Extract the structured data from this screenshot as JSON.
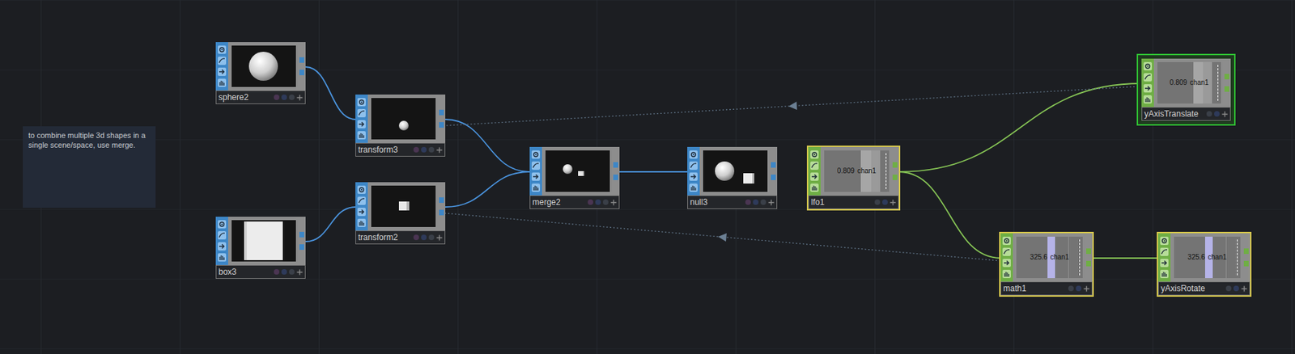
{
  "comment": {
    "text": "to combine multiple 3d shapes in a single scene/space, use merge."
  },
  "nodes": [
    {
      "name": "sphere2",
      "family": "sop",
      "preview": "sphere",
      "selected": false,
      "current": false
    },
    {
      "name": "transform3",
      "family": "sop",
      "preview": "small-sphere",
      "selected": false,
      "current": false
    },
    {
      "name": "box3",
      "family": "sop",
      "preview": "box",
      "selected": false,
      "current": false
    },
    {
      "name": "transform2",
      "family": "sop",
      "preview": "small-box",
      "selected": false,
      "current": false
    },
    {
      "name": "merge2",
      "family": "sop",
      "preview": "merge",
      "selected": false,
      "current": false
    },
    {
      "name": "null3",
      "family": "sop",
      "preview": "null",
      "selected": false,
      "current": false
    },
    {
      "name": "lfo1",
      "family": "chop",
      "preview": "chop-lfo",
      "value": "0.809",
      "channel": "chan1",
      "selected": true,
      "current": false
    },
    {
      "name": "yAxisTranslate",
      "family": "chop",
      "preview": "chop-lfo",
      "value": "0.809",
      "channel": "chan1",
      "selected": false,
      "current": true
    },
    {
      "name": "math1",
      "family": "chop",
      "preview": "chop-math",
      "value": "325.6",
      "channel": "chan1",
      "selected": true,
      "current": false
    },
    {
      "name": "yAxisRotate",
      "family": "chop",
      "preview": "chop-math",
      "value": "325.6",
      "channel": "chan1",
      "selected": true,
      "current": false
    }
  ],
  "connections": [
    {
      "from": "sphere2",
      "to": "transform3",
      "kind": "wire"
    },
    {
      "from": "box3",
      "to": "transform2",
      "kind": "wire"
    },
    {
      "from": "transform3",
      "to": "merge2",
      "kind": "wire"
    },
    {
      "from": "transform2",
      "to": "merge2",
      "kind": "wire"
    },
    {
      "from": "merge2",
      "to": "null3",
      "kind": "wire"
    },
    {
      "from": "lfo1",
      "to": "yAxisTranslate",
      "kind": "wire"
    },
    {
      "from": "lfo1",
      "to": "math1",
      "kind": "wire"
    },
    {
      "from": "math1",
      "to": "yAxisRotate",
      "kind": "wire"
    },
    {
      "from": "yAxisTranslate",
      "to": "transform3",
      "kind": "export"
    },
    {
      "from": "math1",
      "to": "transform2",
      "kind": "export"
    }
  ]
}
